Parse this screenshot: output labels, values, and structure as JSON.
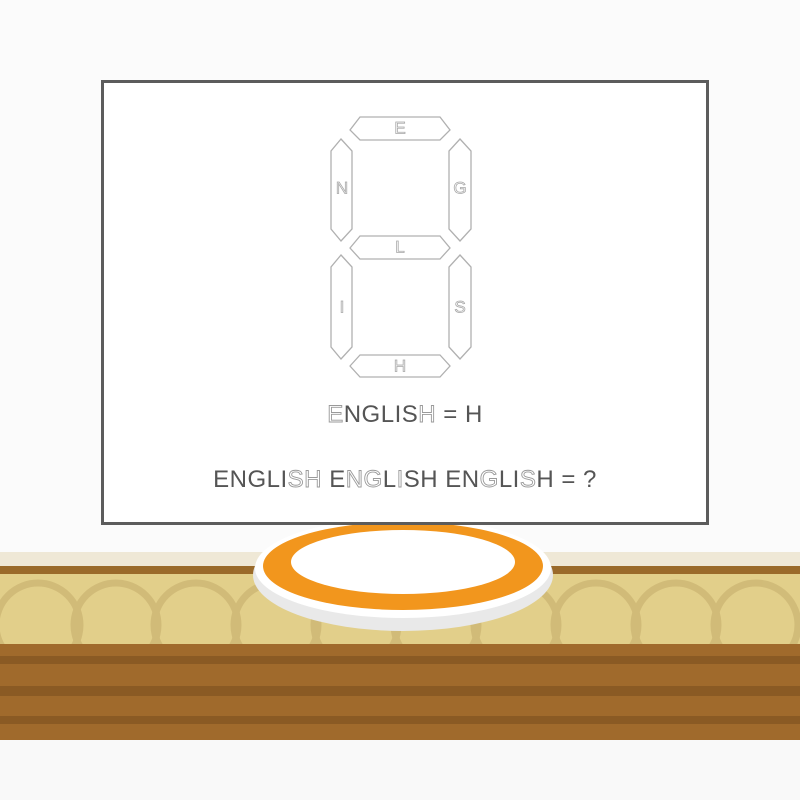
{
  "puzzle": {
    "segments": [
      {
        "id": "top",
        "label": "E"
      },
      {
        "id": "upper-left",
        "label": "N"
      },
      {
        "id": "upper-right",
        "label": "G"
      },
      {
        "id": "middle",
        "label": "L"
      },
      {
        "id": "lower-left",
        "label": "I"
      },
      {
        "id": "lower-right",
        "label": "S"
      },
      {
        "id": "bottom",
        "label": "H"
      }
    ],
    "equation1": {
      "word": "ENGLISH",
      "highlight": [
        0,
        6
      ],
      "rest": " = H"
    },
    "equation2": {
      "words": [
        {
          "text": "ENGLISH",
          "highlight": [
            5,
            6
          ]
        },
        {
          "text": "ENGLISH",
          "highlight": [
            1,
            2,
            4
          ]
        },
        {
          "text": "ENGLISH",
          "highlight": [
            2,
            5
          ]
        }
      ],
      "rest": " = ?"
    }
  },
  "colors": {
    "segment_stroke": "#b0b0b0",
    "caption_text": "#555555",
    "board_border": "#5c5c5c",
    "plate_rim": "#f2961d",
    "shelf_light": "#e2cf8a",
    "shelf_dark": "#a06a2c"
  }
}
